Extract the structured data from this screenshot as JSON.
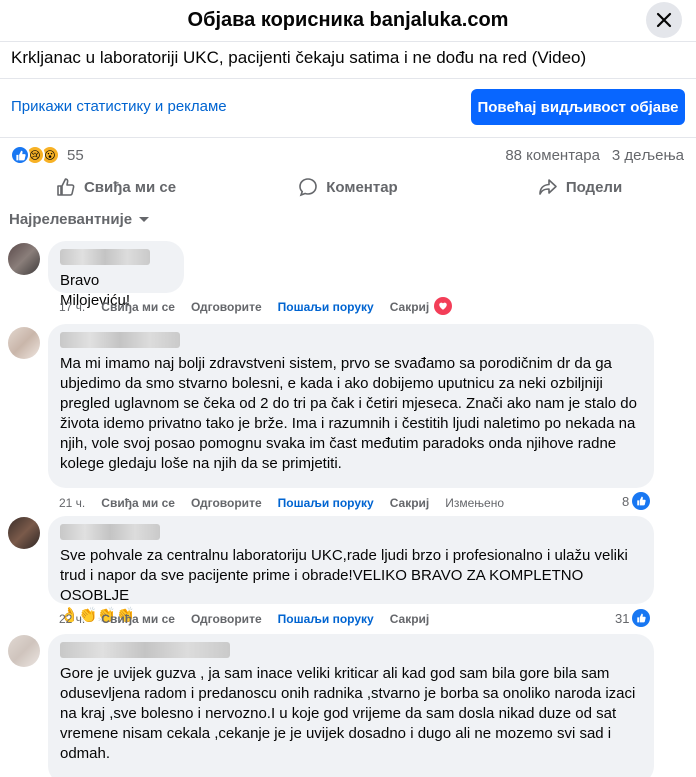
{
  "header": {
    "title": "Објава корисника banjaluka.com"
  },
  "post": {
    "title": "Krkljanac u laboratoriji UKC, pacijenti čekaju satima i ne dođu na red (Video)",
    "stats_link": "Прикажи статистику и рекламе",
    "boost_label": "Повећај видљивост објаве",
    "reaction_count": "55",
    "comments_count": "88 коментара",
    "shares_count": "3 дељења",
    "reactions": [
      "like-icon",
      "sad-icon",
      "wow-icon"
    ]
  },
  "actions": {
    "like": "Свиђа ми се",
    "comment": "Коментар",
    "share": "Подели"
  },
  "sort_label": "Најрелевантније",
  "comments": [
    {
      "text": "Bravo Milojeviću!",
      "time": "17 ч.",
      "like": "Свиђа ми се",
      "reply": "Одговорите",
      "message": "Пошаљи поруку",
      "hide": "Сакриј"
    },
    {
      "text": "Ma mi imamo naj bolji zdravstveni sistem, prvo se svađamo sa porodičnim dr da ga ubjedimo da smo stvarno bolesni, e kada i ako dobijemo uputnicu za neki ozbiljniji pregled uglavnom se čeka od 2 do tri pa čak i četiri mjeseca. Znači ako nam je stalo do života idemo privatno tako je brže. Ima i razumnih i čestitih ljudi naletimo po nekada na njih, vole svoj posao pomognu svaka im čast međutim paradoks onda njihove radne kolege gledaju loše na njih da se primjetiti.",
      "time": "21 ч.",
      "like": "Свиђа ми се",
      "reply": "Одговорите",
      "message": "Пошаљи поруку",
      "hide": "Сакриј",
      "edited": "Измењено",
      "likes": "8"
    },
    {
      "text": "Sve pohvale za centralnu laboratoriju UKC,rade ljudi brzo i profesionalno i ulažu veliki trud i napor da sve pacijente prime i obrade!VELIKO BRAVO ZA KOMPLETNO OSOBLJE",
      "emoji": "👌👏👏👏",
      "time": "22 ч.",
      "like": "Свиђа ми се",
      "reply": "Одговорите",
      "message": "Пошаљи поруку",
      "hide": "Сакриј",
      "likes": "31"
    },
    {
      "text": "Gore je uvijek guzva , ja sam inace veliki kriticar ali kad god sam bila gore bila sam odusevljena radom i predanoscu onih radnika ,stvarno je borba sa onoliko naroda izaci na kraj ,sve bolesno i nervozno.I u koje god vrijeme da sam dosla nikad duze od sat vremene nisam cekala ,cekanje je je uvijek dosadno i dugo ali ne mozemo svi sad i odmah."
    }
  ],
  "colors": {
    "accent": "#0866ff",
    "link": "#0064d1",
    "bubble": "#f0f2f5",
    "heart": "#f33e58"
  }
}
